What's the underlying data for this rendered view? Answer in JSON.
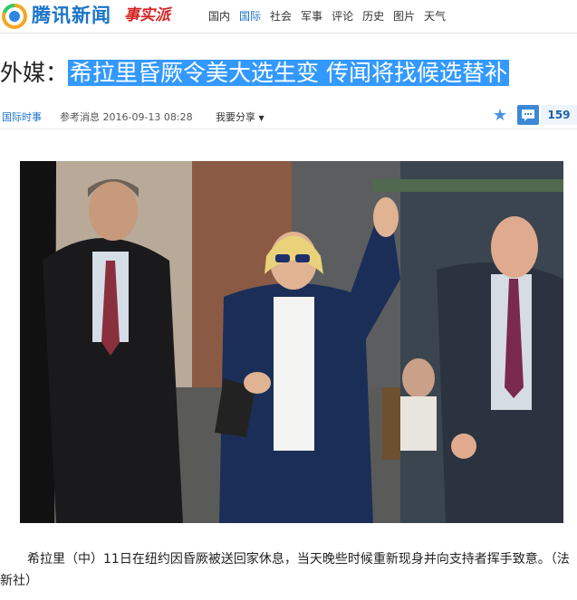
{
  "header": {
    "brand": "腾讯新闻",
    "sub_brand": "事实派",
    "nav": [
      {
        "label": "国内",
        "active": false
      },
      {
        "label": "国际",
        "active": true
      },
      {
        "label": "社会",
        "active": false
      },
      {
        "label": "军事",
        "active": false
      },
      {
        "label": "评论",
        "active": false
      },
      {
        "label": "历史",
        "active": false
      },
      {
        "label": "图片",
        "active": false
      },
      {
        "label": "天气",
        "active": false
      }
    ]
  },
  "article": {
    "title_prefix": "外媒：",
    "title_highlight": "希拉里昏厥令美大选生变 传闻将找候选替补",
    "channel": "国际时事",
    "source_date": "参考消息 2016-09-13 08:28",
    "share_label": "我要分享",
    "comment_count": "159",
    "caption": "希拉里（中）11日在纽约因昏厥被送回家休息，当天晚些时候重新现身并向支持者挥手致意。（法新社）"
  },
  "icons": {
    "logo": "tencent-news-logo",
    "star": "star-icon",
    "comment": "comment-icon",
    "share_caret": "caret-down-icon"
  },
  "colors": {
    "brand_blue": "#1a73c8",
    "highlight": "#3399ff",
    "sub_brand_red": "#d42323"
  }
}
